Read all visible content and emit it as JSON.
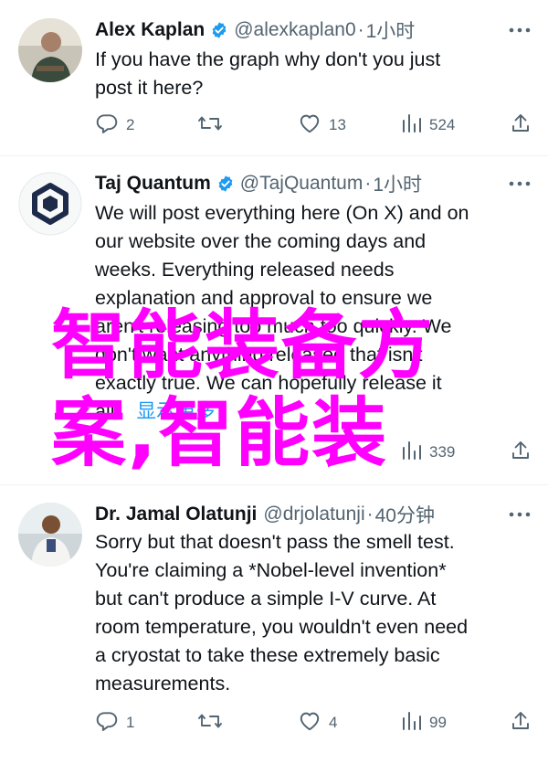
{
  "tweets": [
    {
      "name": "Alex Kaplan",
      "handle": "@alexkaplan0",
      "dot": "·",
      "time": "1小时",
      "lines": [
        "If you have the graph why don't you just",
        "post it here?"
      ],
      "replies": "2",
      "retweets": "",
      "likes": "13",
      "views": "524"
    },
    {
      "name": "Taj Quantum",
      "handle": "@TajQuantum",
      "dot": "·",
      "time": "1小时",
      "lines": [
        "We will post everything here (On X) and on",
        "our website over the coming days and",
        "weeks. Everything released needs",
        "explanation and approval to ensure we",
        "aren't releasing too much too quickly. We",
        "don't want anything released that isn't",
        "exactly true. We can hopefully release it",
        "all."
      ],
      "show_more": "显示更多",
      "views": "339"
    },
    {
      "name": "Dr. Jamal Olatunji",
      "handle": "@drjolatunji",
      "dot": "·",
      "time": "40分钟",
      "lines": [
        "Sorry but that doesn't pass the smell test.",
        "You're claiming a *Nobel-level invention*",
        "but can't produce a simple I-V curve. At",
        "room temperature, you wouldn't even need",
        "a cryostat to take these extremely basic",
        "measurements."
      ],
      "replies": "1",
      "retweets": "",
      "likes": "4",
      "views": "99"
    }
  ],
  "watermark": {
    "line1": "智能装备方",
    "line2": "案,智能装",
    "color": "#ff00ff"
  },
  "colors": {
    "verified": "#1d9bf0",
    "secondary": "#536471",
    "link": "#1d9bf0"
  },
  "icons": [
    "verified-badge-icon",
    "more-icon",
    "reply-icon",
    "retweet-icon",
    "like-icon",
    "views-icon",
    "share-icon"
  ]
}
